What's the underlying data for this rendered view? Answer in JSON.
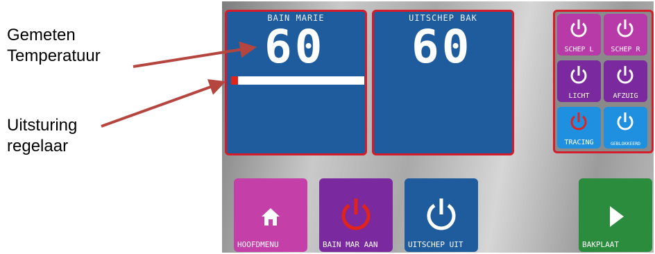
{
  "annotations": {
    "measured_temp": [
      "Gemeten",
      "Temperatuur"
    ],
    "controller_output": [
      "Uitsturing",
      "regelaar"
    ]
  },
  "panels": {
    "bain_marie": {
      "title": "BAIN MARIE",
      "value": "60",
      "output_level": 0.05
    },
    "uitschep_bak": {
      "title": "UITSCHEP BAK",
      "value": "60"
    }
  },
  "side_buttons": [
    {
      "label": "SCHEP L",
      "color": "#b83aa8",
      "icon": "power-icon"
    },
    {
      "label": "SCHEP R",
      "color": "#b83aa8",
      "icon": "power-icon"
    },
    {
      "label": "LICHT",
      "color": "#7a2a9e",
      "icon": "power-icon"
    },
    {
      "label": "AFZUIG",
      "color": "#7a2a9e",
      "icon": "power-icon"
    },
    {
      "label": "TRACING",
      "color": "#1f8fe0",
      "icon": "power-icon",
      "icon_color": "#e0241c"
    },
    {
      "label": "GEBLOKKEERD",
      "color": "#1f8fe0",
      "icon": "power-icon"
    }
  ],
  "bottom_buttons": [
    {
      "label": "HOOFDMENU",
      "color": "#c43fa8",
      "icon": "home-icon"
    },
    {
      "label": "BAIN MAR AAN",
      "color": "#7a2a9e",
      "icon": "power-icon",
      "icon_color": "#e0241c"
    },
    {
      "label": "UITSCHEP UIT",
      "color": "#1f5c9e",
      "icon": "power-icon"
    },
    {
      "label": "BAKPLAAT",
      "color": "#2a8c3c",
      "icon": "play-icon"
    }
  ],
  "colors": {
    "panel_bg": "#1f5c9e",
    "panel_border": "#d41c2a",
    "arrow": "#b5453f",
    "bar_fill": "#e0241c"
  }
}
